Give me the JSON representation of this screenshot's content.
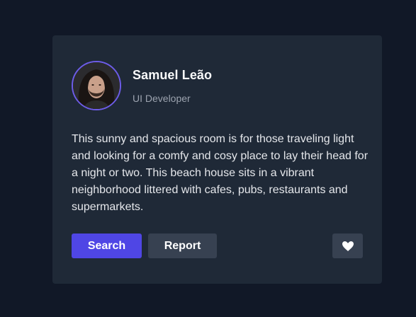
{
  "profile": {
    "name": "Samuel Leão",
    "role": "UI Developer"
  },
  "description": "This sunny and spacious room is for those traveling light and looking for a comfy and cosy place to lay their head for a night or two. This beach house sits in a vibrant neighborhood littered with cafes, pubs, restaurants and supermarkets.",
  "actions": {
    "search_label": "Search",
    "report_label": "Report",
    "like_icon": "heart-icon"
  },
  "colors": {
    "page_bg": "#111827",
    "card_bg": "#1f2937",
    "primary": "#4f46e5",
    "secondary": "#374151",
    "avatar_ring": "#6d5ce8"
  }
}
